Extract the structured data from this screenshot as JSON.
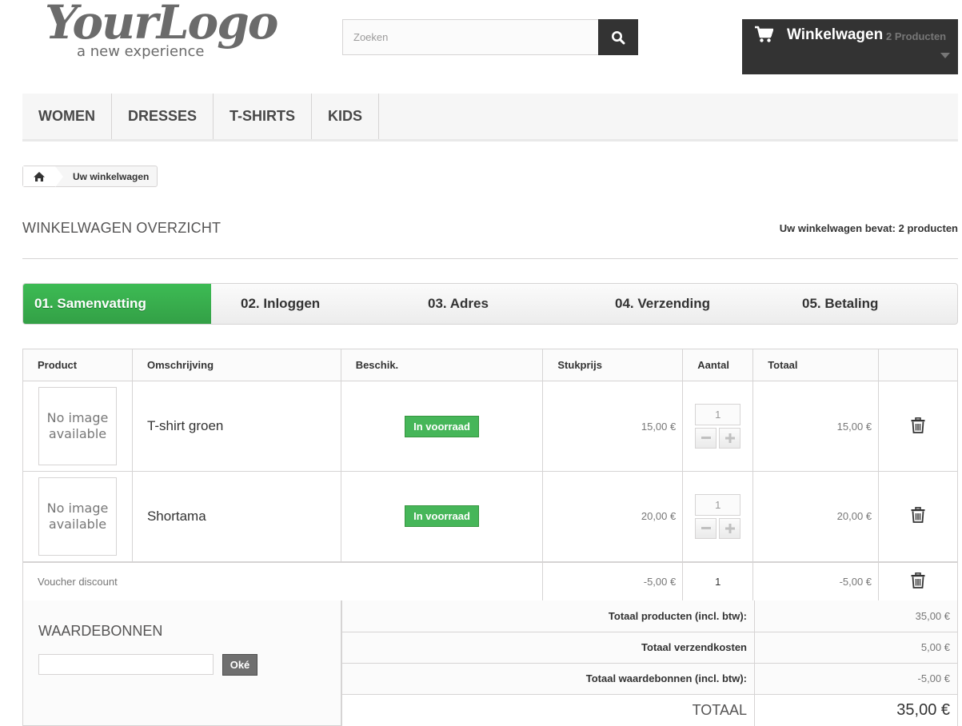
{
  "header": {
    "logo_text": "YourLogo",
    "logo_tagline": "a new experience",
    "search_placeholder": "Zoeken",
    "cart_title": "Winkelwagen",
    "cart_count": "2 Producten"
  },
  "nav": {
    "items": [
      "WOMEN",
      "DRESSES",
      "T-SHIRTS",
      "KIDS"
    ]
  },
  "breadcrumb": {
    "current": "Uw winkelwagen"
  },
  "page": {
    "title": "WINKELWAGEN OVERZICHT",
    "counter": "Uw winkelwagen bevat: 2 producten"
  },
  "steps": [
    "01. Samenvatting",
    "02. Inloggen",
    "03. Adres",
    "04. Verzending",
    "05. Betaling"
  ],
  "table": {
    "headers": [
      "Product",
      "Omschrijving",
      "Beschik.",
      "Stukprijs",
      "Aantal",
      "Totaal"
    ],
    "no_image_text": "No image available",
    "rows": [
      {
        "name": "T-shirt groen",
        "availability": "In voorraad",
        "unit_price": "15,00 €",
        "quantity": "1",
        "total": "15,00 €"
      },
      {
        "name": "Shortama",
        "availability": "In voorraad",
        "unit_price": "20,00 €",
        "quantity": "1",
        "total": "20,00 €"
      }
    ],
    "voucher_row": {
      "label": "Voucher discount",
      "unit_price": "-5,00 €",
      "quantity": "1",
      "total": "-5,00 €"
    }
  },
  "vouchers": {
    "title": "WAARDEBONNEN",
    "input_value": "",
    "button_label": "Oké"
  },
  "totals": [
    {
      "label": "Totaal producten (incl. btw):",
      "value": "35,00 €"
    },
    {
      "label": "Totaal verzendkosten",
      "value": "5,00 €"
    },
    {
      "label": "Totaal waardebonnen (incl. btw):",
      "value": "-5,00 €"
    },
    {
      "label": "TOTAAL",
      "value": "35,00 €"
    }
  ],
  "colors": {
    "dark": "#333333",
    "accent_green": "#46b659",
    "border": "#d6d4d4",
    "light_bg": "#f6f6f6"
  },
  "icons": {
    "search": "search-icon",
    "cart": "shopping-cart-icon",
    "caret": "caret-down-icon",
    "home": "home-icon",
    "delete": "trash-icon"
  }
}
